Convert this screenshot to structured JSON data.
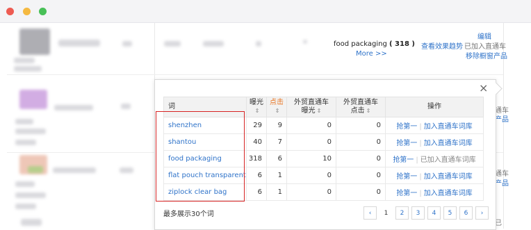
{
  "window": {
    "controls": [
      "close",
      "minimize",
      "maximize"
    ]
  },
  "row": {
    "keyword": "food packaging",
    "keyword_count": "( 318 )",
    "more": "More >>",
    "view_trend": "查看效果趋势",
    "edit": "编辑",
    "added_status": "已加入直通车",
    "remove_window": "移除橱窗产品"
  },
  "right_fragments": [
    "通车",
    "产品",
    "通车",
    "产品",
    "已"
  ],
  "popup": {
    "close_icon": "×",
    "headers": {
      "word": "词",
      "impressions": "曝光",
      "clicks": "点击",
      "ext_impressions": "外贸直通车\n曝光",
      "ext_clicks": "外贸直通车\n点击",
      "ops": "操作"
    },
    "rows": [
      {
        "word": "shenzhen",
        "impressions": "29",
        "clicks": "9",
        "ext_impressions": "0",
        "ext_clicks": "0",
        "op1": "抢第一",
        "op2": "加入直通车词库",
        "added": false
      },
      {
        "word": "shantou",
        "impressions": "40",
        "clicks": "7",
        "ext_impressions": "0",
        "ext_clicks": "0",
        "op1": "抢第一",
        "op2": "加入直通车词库",
        "added": false
      },
      {
        "word": "food packaging",
        "impressions": "318",
        "clicks": "6",
        "ext_impressions": "10",
        "ext_clicks": "0",
        "op1": "抢第一",
        "op2": "已加入直通车词库",
        "added": true
      },
      {
        "word": "flat pouch transparent",
        "impressions": "6",
        "clicks": "1",
        "ext_impressions": "0",
        "ext_clicks": "0",
        "op1": "抢第一",
        "op2": "加入直通车词库",
        "added": false
      },
      {
        "word": "ziplock clear bag",
        "impressions": "6",
        "clicks": "1",
        "ext_impressions": "0",
        "ext_clicks": "0",
        "op1": "抢第一",
        "op2": "加入直通车词库",
        "added": false
      }
    ],
    "footnote": "最多展示30个词",
    "pager": {
      "prev": "‹",
      "pages": [
        "1",
        "2",
        "3",
        "4",
        "5",
        "6"
      ],
      "current": "1",
      "next": "›"
    }
  },
  "colors": {
    "link": "#2f73c9",
    "highlight_box": "#d62222",
    "click_header": "#e8731f"
  }
}
